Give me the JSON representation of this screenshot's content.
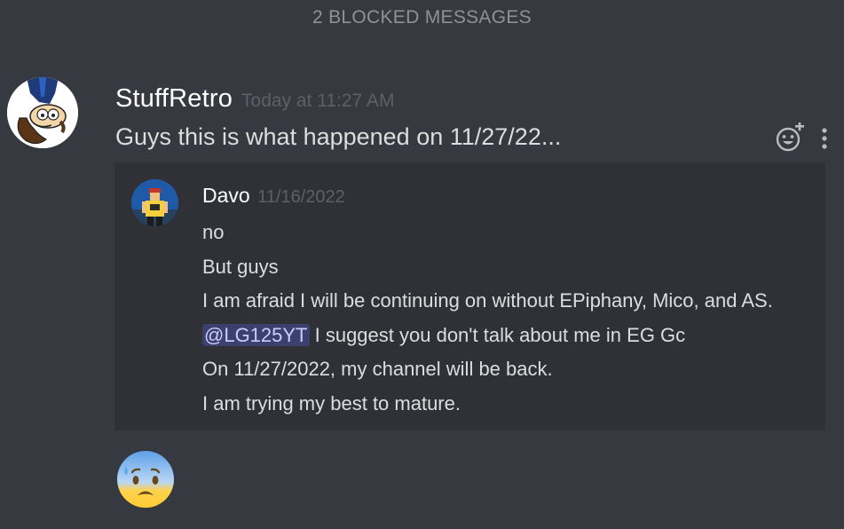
{
  "blocked_messages": "2 BLOCKED MESSAGES",
  "message": {
    "author": "StuffRetro",
    "timestamp": "Today at 11:27 AM",
    "text": "Guys this is what happened on 11/27/22...",
    "avatar_icon": "cartoon-character-avatar",
    "actions": {
      "add_reaction_icon": "add-reaction-icon",
      "more_icon": "more-options-icon"
    }
  },
  "embed": {
    "author": "Davo",
    "date": "11/16/2022",
    "avatar_icon": "roblox-character-avatar",
    "lines": [
      {
        "text": "no"
      },
      {
        "text": "But guys"
      },
      {
        "text": "I am afraid I will be continuing on without EPiphany, Mico, and AS."
      },
      {
        "mention": "@LG125YT",
        "text": " I suggest you don't talk about me in EG Gc"
      },
      {
        "text": "On 11/27/2022, my channel will be back."
      },
      {
        "text": "I am trying my best to mature."
      }
    ]
  },
  "reaction_emoji": "anxious-face-with-sweat",
  "colors": {
    "background": "#36393f",
    "embed_background": "#2f3136",
    "mention_background": "#414675",
    "mention_text": "#c9cdfb",
    "author": "#ffffff",
    "muted": "#5d6066"
  }
}
